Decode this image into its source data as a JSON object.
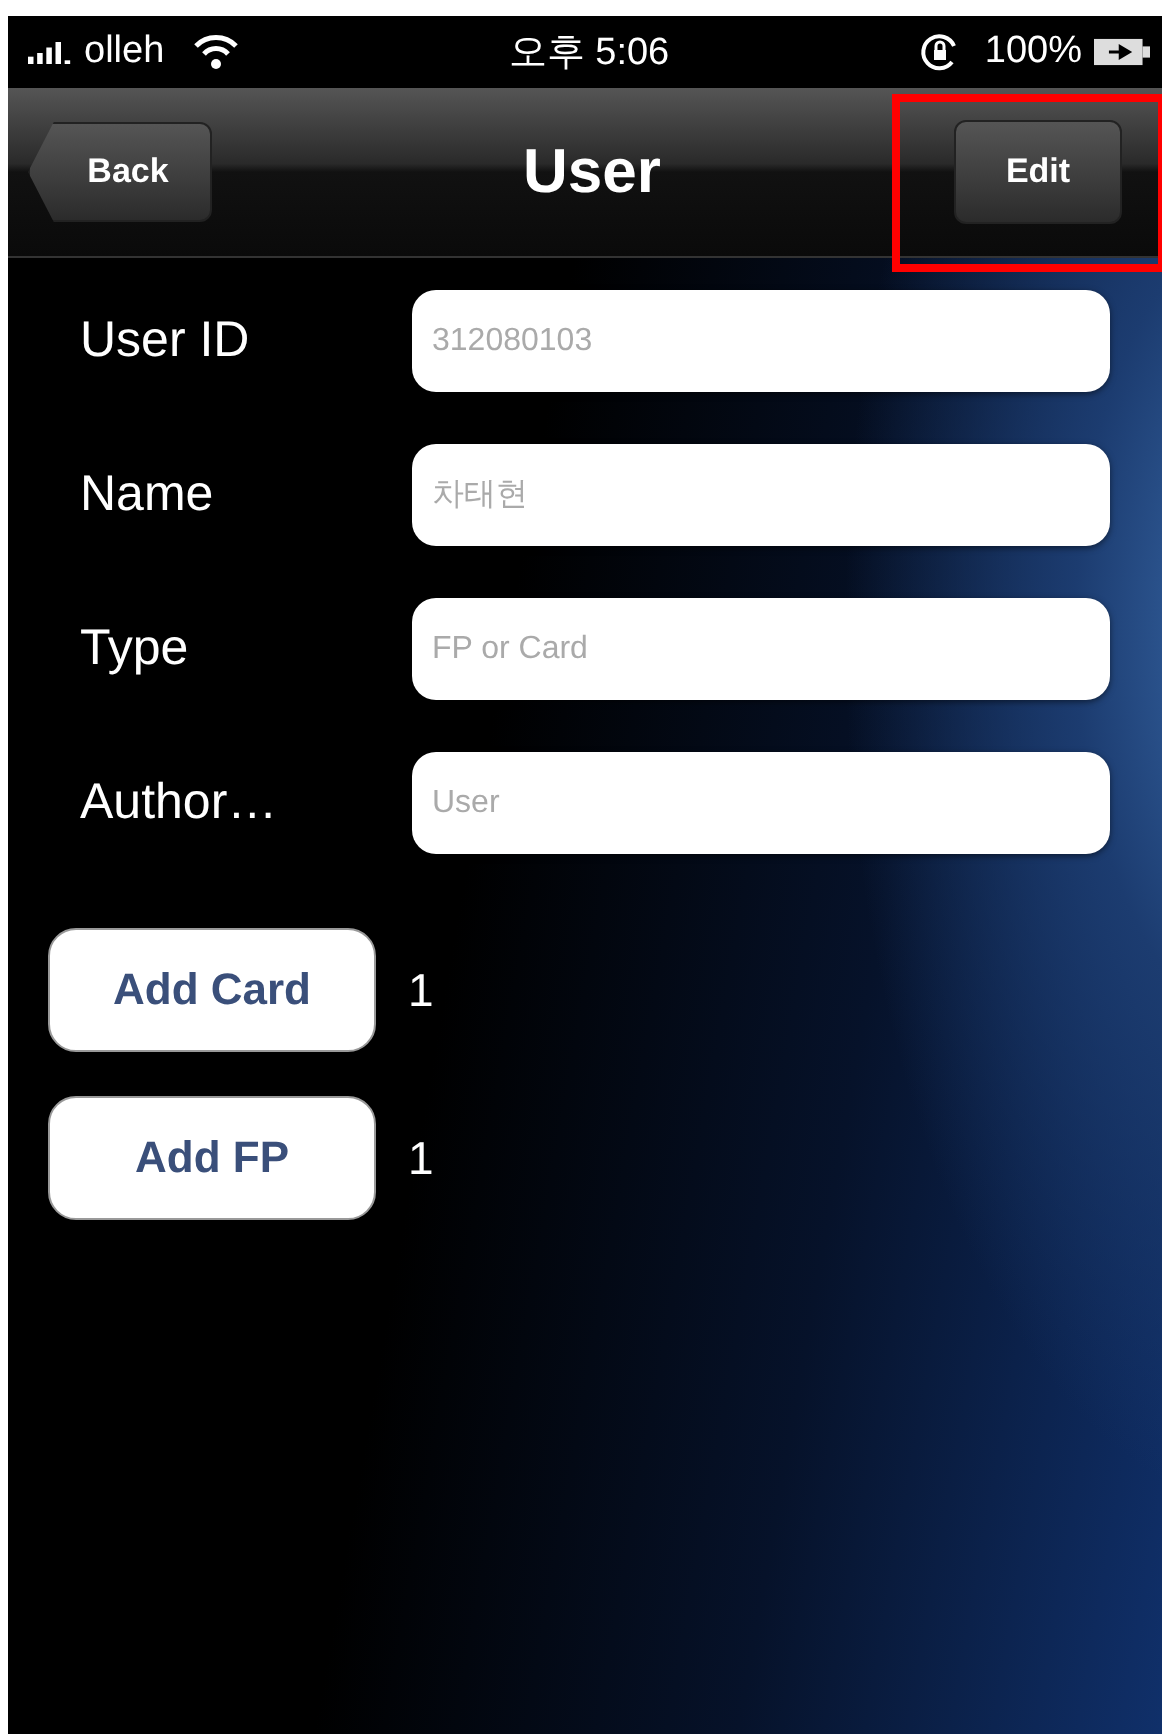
{
  "status_bar": {
    "carrier": "olleh",
    "time": "오후 5:06",
    "battery": "100%"
  },
  "nav_bar": {
    "back": "Back",
    "title": "User",
    "edit": {
      "label": "Edit",
      "highlighted": true
    }
  },
  "fields": [
    {
      "label": "User ID",
      "placeholder": "312080103"
    },
    {
      "label": "Name",
      "placeholder": "차태현"
    },
    {
      "label": "Type",
      "placeholder": "FP or Card"
    },
    {
      "label": "Author…",
      "placeholder": "User"
    }
  ],
  "actions": [
    {
      "label": "Add Card",
      "count": "1"
    },
    {
      "label": "Add FP",
      "count": "1"
    }
  ]
}
